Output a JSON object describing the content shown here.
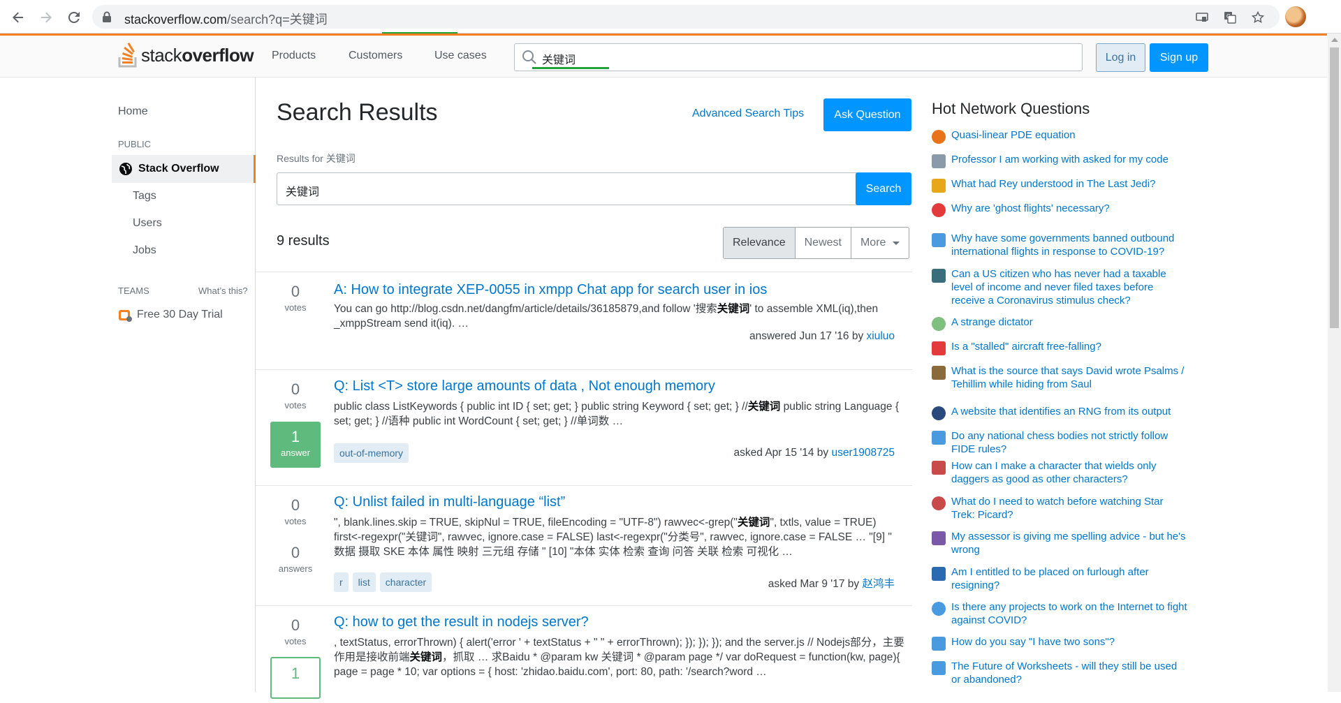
{
  "browser": {
    "url_host": "stackoverflow.com",
    "url_rest": "/search?q=关键词"
  },
  "header": {
    "logo_light": "stack",
    "logo_bold": "overflow",
    "nav": [
      "Products",
      "Customers",
      "Use cases"
    ],
    "search_value": "关键词",
    "login_label": "Log in",
    "signup_label": "Sign up"
  },
  "sidebar": {
    "home": "Home",
    "public_label": "PUBLIC",
    "active": "Stack Overflow",
    "items": [
      "Tags",
      "Users",
      "Jobs"
    ],
    "teams_label": "TEAMS",
    "whats_this": "What’s this?",
    "trial": "Free 30 Day Trial"
  },
  "main": {
    "title": "Search Results",
    "advanced_tips": "Advanced Search Tips",
    "ask_label": "Ask Question",
    "results_for": "Results for 关键词",
    "search_value": "关键词",
    "search_label": "Search",
    "count": "9 results",
    "sort": [
      "Relevance",
      "Newest",
      "More"
    ],
    "results": [
      {
        "votes": "0",
        "votes_label": "votes",
        "answers": "",
        "answers_label": "",
        "title": "A: How to integrate XEP-0055 in xmpp Chat app for search user in ios",
        "excerpt_pre": "You can go http://blog.csdn.net/dangfm/article/details/36185879,and follow '搜索",
        "excerpt_hl": "关键词",
        "excerpt_post": "' to assemble XML(iq),then _xmppStream send it(iq). …",
        "tags": [],
        "meta_action": "answered Jun 17 '16 by ",
        "user": "xiuluo"
      },
      {
        "votes": "0",
        "votes_label": "votes",
        "answers": "1",
        "answers_label": "answer",
        "title": "Q: List <T> store large amounts of data , Not enough memory",
        "excerpt_pre": "public class ListKeywords { public int ID { set; get; } public string Keyword { set; get; } //",
        "excerpt_hl": "关键词",
        "excerpt_post": " public string Language { set; get; } //语种 public int WordCount { set; get; } //单词数 …",
        "tags": [
          "out-of-memory"
        ],
        "meta_action": "asked Apr 15 '14 by ",
        "user": "user1908725"
      },
      {
        "votes": "0",
        "votes_label": "votes",
        "answers": "0",
        "answers_label": "answers",
        "title": "Q: Unlist failed in multi-language “list”",
        "excerpt_pre": "\", blank.lines.skip = TRUE, skipNul = TRUE, fileEncoding = \"UTF-8\") rawvec<-grep(\"",
        "excerpt_hl": "关键词",
        "excerpt_post": "\", txtls, value = TRUE) first<-regexpr(\"关键词\", rawvec, ignore.case = FALSE) last<-regexpr(\"分类号\", rawvec, ignore.case = FALSE … \"[9] \" 数据 摄取 SKE 本体 属性 映射 三元组 存储 \" [10] \"本体 实体 检索 查询 问答 关联 检索 可视化 …",
        "tags": [
          "r",
          "list",
          "character"
        ],
        "meta_action": "asked Mar 9 '17 by ",
        "user": "赵鸿丰"
      },
      {
        "votes": "0",
        "votes_label": "votes",
        "answers": "1",
        "answers_label": "",
        "title": "Q: how to get the result in nodejs server?",
        "excerpt_pre": ", textStatus, errorThrown) { alert('error ' + textStatus + \" \" + errorThrown); }); }); }); and the server.js // Nodejs部分，主要作用是接收前端",
        "excerpt_hl": "关键词",
        "excerpt_post": "，抓取 … 求Baidu * @param kw 关键词 * @param page */ var doRequest = function(kw, page){ page = page * 10; var options = { host: 'zhidao.baidu.com', port: 80, path: '/search?word …",
        "tags": [],
        "meta_action": "",
        "user": ""
      }
    ]
  },
  "hot": {
    "title": "Hot Network Questions",
    "items": [
      {
        "text": "Quasi-linear PDE equation",
        "color": "#e8731a"
      },
      {
        "text": "Professor I am working with asked for my code",
        "color": "#8a9aa8"
      },
      {
        "text": "What had Rey understood in The Last Jedi?",
        "color": "#e8a71a"
      },
      {
        "text": "Why are 'ghost flights' necessary?",
        "color": "#e33b3b"
      },
      {
        "text": "Why have some governments banned outbound international flights in response to COVID-19?",
        "color": "#4a9ae0"
      },
      {
        "text": "Can a US citizen who has never had a taxable level of income and never filed taxes before receive a Coronavirus stimulus check?",
        "color": "#3a6e7c"
      },
      {
        "text": "A strange dictator",
        "color": "#7fbf7f"
      },
      {
        "text": "Is a \"stalled\" aircraft free-falling?",
        "color": "#e33b3b"
      },
      {
        "text": "What is the source that says David wrote Psalms / Tehillim while hiding from Saul",
        "color": "#8a6a3a"
      },
      {
        "text": "A website that identifies an RNG from its output",
        "color": "#2a4a7c"
      },
      {
        "text": "Do any national chess bodies not strictly follow FIDE rules?",
        "color": "#4a9ae0"
      },
      {
        "text": "How can I make a character that wields only daggers as good as other characters?",
        "color": "#c84a4a"
      },
      {
        "text": "What do I need to watch before watching Star Trek: Picard?",
        "color": "#c84a4a"
      },
      {
        "text": "My assessor is giving me spelling advice - but he's wrong",
        "color": "#7a5aa8"
      },
      {
        "text": "Am I entitled to be placed on furlough after resigning?",
        "color": "#2a6ab0"
      },
      {
        "text": "Is there any projects to work on the Internet to fight against COVID?",
        "color": "#4a9ae0"
      },
      {
        "text": "How do you say \"I have two sons\"?",
        "color": "#4a9ae0"
      },
      {
        "text": "The Future of Worksheets - will they still be used or abandoned?",
        "color": "#4a9ae0"
      }
    ]
  }
}
